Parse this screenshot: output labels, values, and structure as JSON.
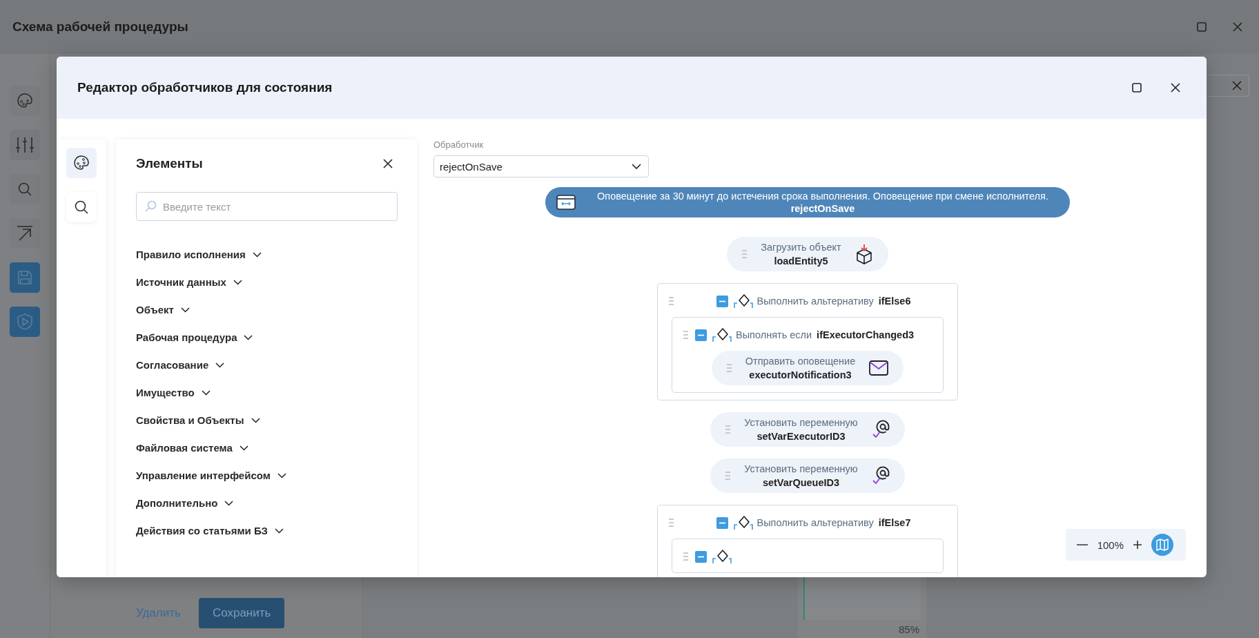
{
  "window": {
    "title": "Схема рабочей процедуры"
  },
  "background": {
    "delete_link": "Удалить",
    "save_button": "Сохранить",
    "minimap_zoom": "85%"
  },
  "dialog": {
    "title": "Редактор обработчиков для состояния",
    "rail": [
      {
        "kind": "palette",
        "selected": true
      },
      {
        "kind": "search",
        "selected": false
      }
    ],
    "elements_panel": {
      "title": "Элементы",
      "search": {
        "placeholder": "Введите текст"
      },
      "groups": [
        {
          "label": "Правило исполнения",
          "expanded": false
        },
        {
          "label": "Источник данных",
          "expanded": false
        },
        {
          "label": "Объект",
          "expanded": false
        },
        {
          "label": "Рабочая процедура",
          "expanded": false
        },
        {
          "label": "Согласование",
          "expanded": false
        },
        {
          "label": "Имущество",
          "expanded": false
        },
        {
          "label": "Свойства и Объекты",
          "expanded": false
        },
        {
          "label": "Файловая система",
          "expanded": false
        },
        {
          "label": "Управление интерфейсом",
          "expanded": false
        },
        {
          "label": "Дополнительно",
          "expanded": false
        },
        {
          "label": "Действия со статьями БЗ",
          "expanded": false
        }
      ]
    },
    "handler_field": {
      "label": "Обработчик",
      "value": "rejectOnSave"
    },
    "flow": {
      "banner": {
        "description": "Оповещение за 30 минут до истечения срока выполнения. Оповещение при смене исполнителя.",
        "name": "rejectOnSave"
      },
      "nodes": [
        {
          "kind": "load",
          "title": "Загрузить объект",
          "name": "loadEntity5"
        },
        {
          "kind": "branch",
          "title": "Выполнить альтернативу",
          "name": "ifElse6",
          "expanded": true,
          "children": [
            {
              "kind": "branch",
              "title": "Выполнять если",
              "name": "ifExecutorChanged3",
              "expanded": true,
              "children": [
                {
                  "kind": "notification",
                  "title": "Отправить оповещение",
                  "name": "executorNotification3"
                }
              ]
            }
          ]
        },
        {
          "kind": "variable",
          "title": "Установить переменную",
          "name": "setVarExecutorID3"
        },
        {
          "kind": "variable",
          "title": "Установить переменную",
          "name": "setVarQueueID3"
        },
        {
          "kind": "branch",
          "title": "Выполнить альтернативу",
          "name": "ifElse7",
          "expanded": true,
          "children": [
            {
              "kind": "branch",
              "expanded": true
            }
          ]
        }
      ]
    },
    "zoom": {
      "value": "100%"
    }
  }
}
